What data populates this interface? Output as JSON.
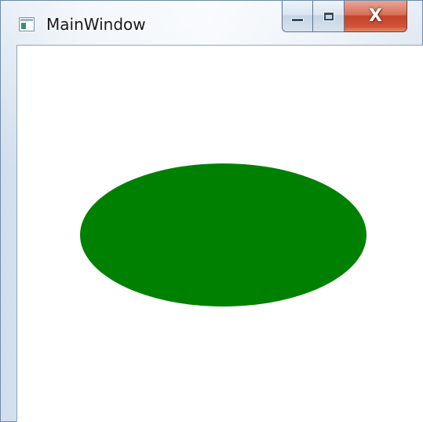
{
  "window": {
    "title": "MainWindow",
    "app_icon": "wpf-window-icon",
    "caption_buttons": {
      "minimize_icon": "minimize-icon",
      "maximize_icon": "maximize-icon",
      "close_icon": "close-icon",
      "close_glyph": "X"
    }
  },
  "content": {
    "shape": "ellipse",
    "fill_color": "#008000"
  },
  "colors": {
    "client_background": "#ffffff",
    "close_button": "#c4432a"
  }
}
